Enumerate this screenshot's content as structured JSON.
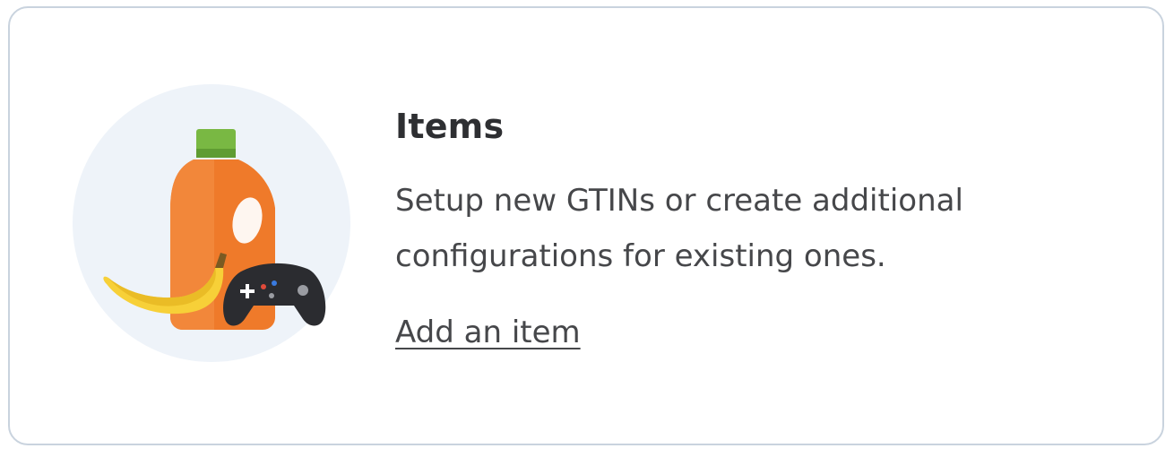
{
  "card": {
    "title": "Items",
    "description": "Setup new GTINs or create additional configurations for existing ones.",
    "link_label": "Add an item",
    "illustration": {
      "icons": [
        "detergent-bottle-icon",
        "banana-icon",
        "game-controller-icon"
      ],
      "circle_color": "#eef3f9"
    }
  },
  "colors": {
    "card_border": "#c9d3de",
    "title": "#2e2f32",
    "text": "#46474a",
    "bottle_orange": "#ef7a2a",
    "bottle_cap": "#79b843",
    "banana_yellow": "#f7d038",
    "controller_dark": "#2b2c30"
  }
}
